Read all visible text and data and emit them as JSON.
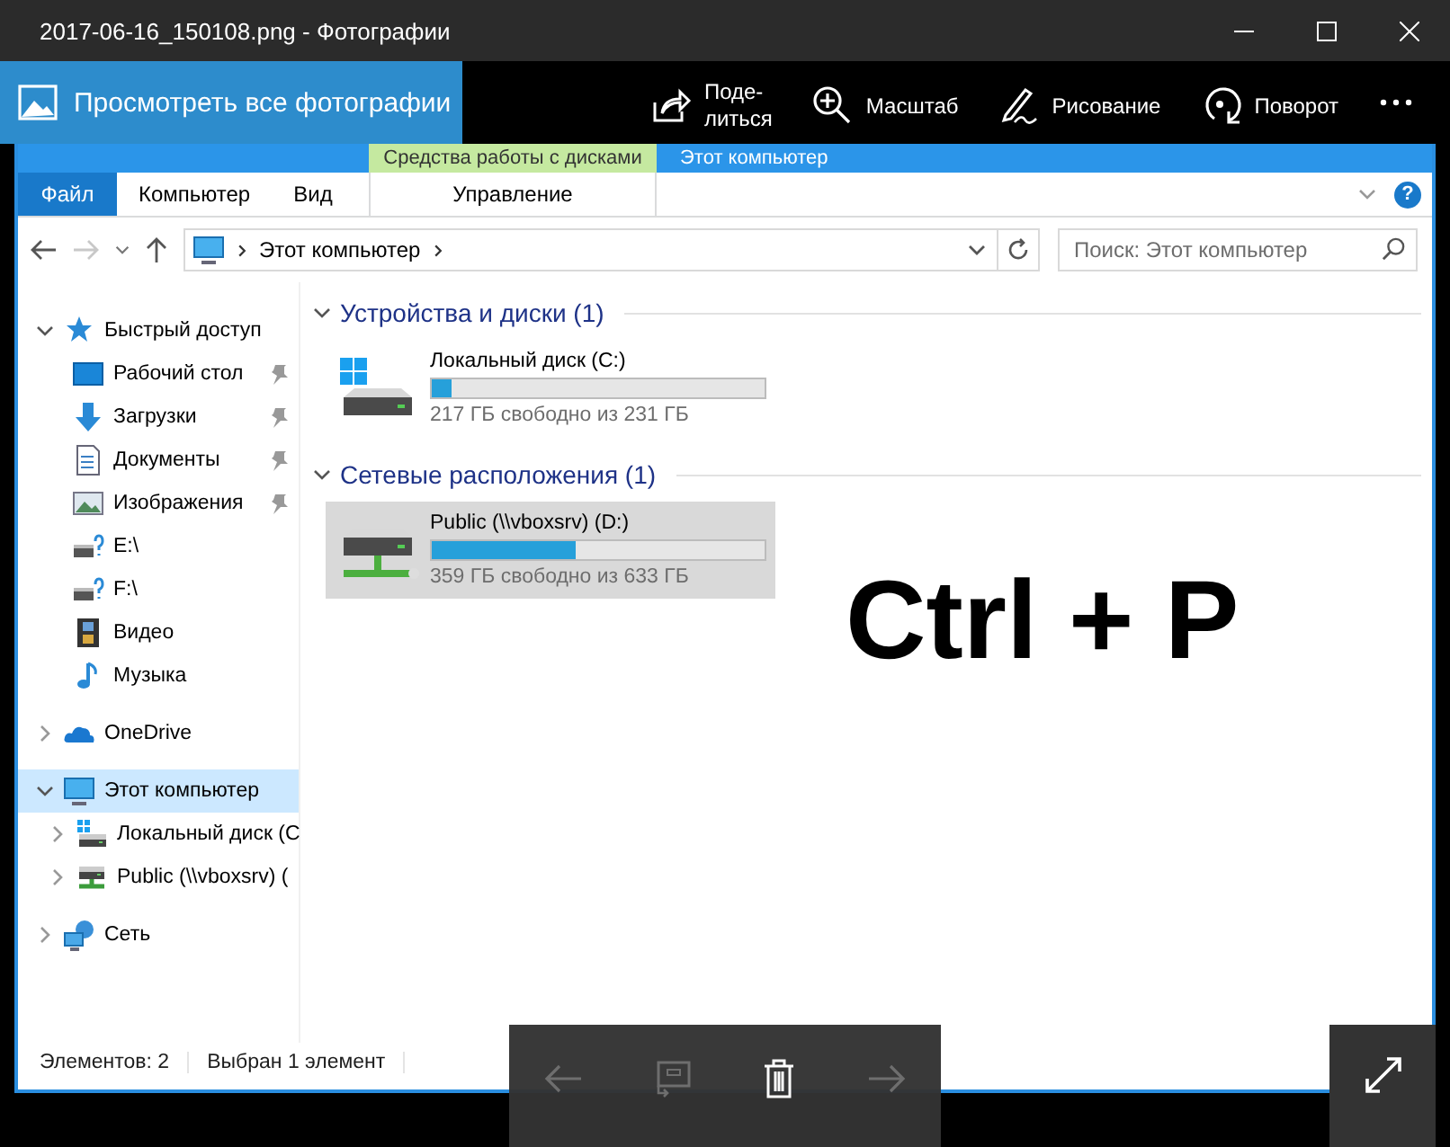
{
  "window": {
    "title": "2017-06-16_150108.png - Фотографии"
  },
  "toolbar": {
    "all_photos": "Просмотреть все фотографии",
    "actions": [
      {
        "kind": "share",
        "label": "Поде-\nлиться"
      },
      {
        "kind": "zoom",
        "label": "Масштаб"
      },
      {
        "kind": "draw",
        "label": "Рисование"
      },
      {
        "kind": "rotate",
        "label": "Поворот"
      }
    ]
  },
  "explorer": {
    "context_group": "Средства работы с дисками",
    "title": "Этот компьютер",
    "tabs": [
      {
        "label": "Файл",
        "kind": "file",
        "selected": false
      },
      {
        "label": "Компьютер",
        "kind": "tab",
        "selected": false
      },
      {
        "label": "Вид",
        "kind": "tab",
        "selected": false
      },
      {
        "label": "Управление",
        "kind": "context",
        "selected": false
      }
    ],
    "help": "?",
    "nav_buttons": [
      {
        "kind": "back",
        "disabled": false
      },
      {
        "kind": "forward",
        "disabled": true
      }
    ],
    "address": {
      "path": [
        "Этот компьютер"
      ]
    },
    "search": {
      "placeholder": "Поиск: Этот компьютер"
    },
    "tree": [
      {
        "label": "Быстрый доступ",
        "kind": "quick-access",
        "expanded": true,
        "selected": false,
        "children": [
          {
            "label": "Рабочий стол",
            "kind": "desktop",
            "pinned": true,
            "selected": false
          },
          {
            "label": "Загрузки",
            "kind": "downloads",
            "pinned": true,
            "selected": false
          },
          {
            "label": "Документы",
            "kind": "documents",
            "pinned": true,
            "selected": false
          },
          {
            "label": "Изображения",
            "kind": "pictures",
            "pinned": true,
            "selected": false
          },
          {
            "label": "E:\\",
            "kind": "drive",
            "pinned": false,
            "selected": false
          },
          {
            "label": "F:\\",
            "kind": "drive",
            "pinned": false,
            "selected": false
          },
          {
            "label": "Видео",
            "kind": "video",
            "pinned": false,
            "selected": false
          },
          {
            "label": "Музыка",
            "kind": "music",
            "pinned": false,
            "selected": false
          }
        ]
      },
      {
        "label": "OneDrive",
        "kind": "onedrive",
        "expanded": false,
        "selected": false
      },
      {
        "label": "Этот компьютер",
        "kind": "computer",
        "expanded": true,
        "selected": true,
        "children": [
          {
            "label": "Локальный диск (C",
            "kind": "local-disk",
            "expanded": false,
            "selected": false
          },
          {
            "label": "Public (\\\\vboxsrv) (",
            "kind": "network-drive",
            "expanded": false,
            "selected": false
          }
        ]
      },
      {
        "label": "Сеть",
        "kind": "network",
        "expanded": false,
        "selected": false
      }
    ],
    "groups": [
      {
        "title": "Устройства и диски (1)",
        "expanded": true,
        "drives": [
          {
            "name": "Локальный диск (C:)",
            "kind": "local-disk",
            "level": 0.06,
            "free": "217 ГБ свободно из 231 ГБ",
            "selected": false
          }
        ]
      },
      {
        "title": "Сетевые расположения (1)",
        "expanded": true,
        "drives": [
          {
            "name": "Public (\\\\vboxsrv) (D:)",
            "kind": "network-drive",
            "level": 0.43,
            "free": "359 ГБ свободно из 633 ГБ",
            "selected": true
          }
        ]
      }
    ],
    "status_bar": [
      "Элементов: 2",
      "Выбран 1 элемент"
    ]
  },
  "overlay_text": "Ctrl + P",
  "viewer_controls": [
    {
      "kind": "previous",
      "disabled": true
    },
    {
      "kind": "slideshow",
      "disabled": true
    },
    {
      "kind": "delete",
      "disabled": false
    },
    {
      "kind": "next",
      "disabled": true
    }
  ]
}
